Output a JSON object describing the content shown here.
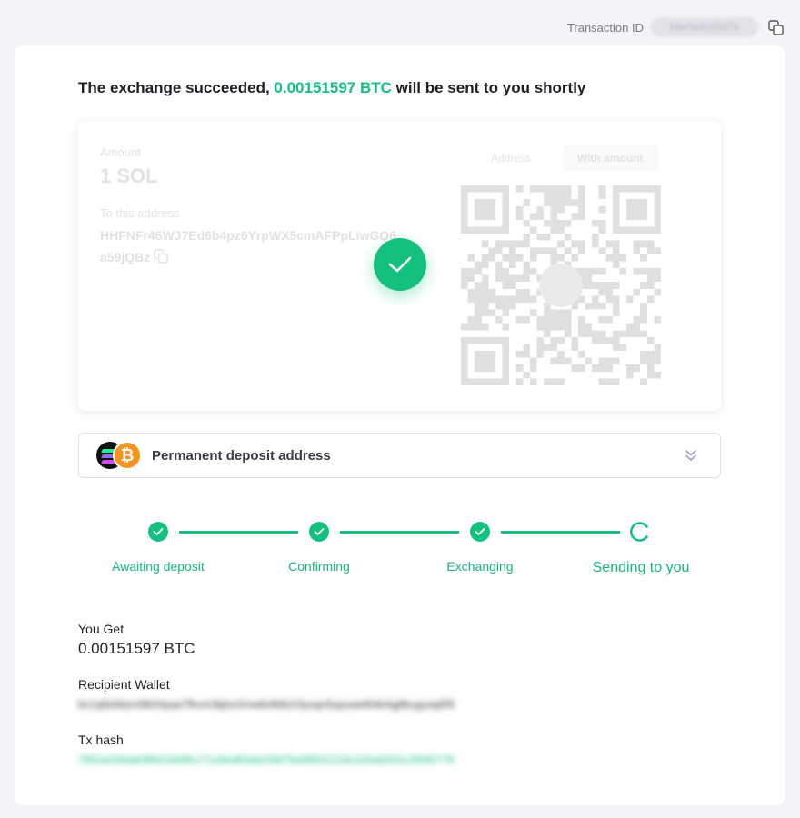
{
  "header": {
    "transaction_id_label": "Transaction ID",
    "transaction_id_value": "b8e0a9c1f2d7a",
    "copy_icon": "copy-icon"
  },
  "headline": {
    "prefix": "The exchange succeeded, ",
    "amount": "0.00151597 BTC",
    "suffix": " will be sent to you shortly"
  },
  "deposit": {
    "amount_label": "Amount",
    "amount_value": "1 SOL",
    "address_label": "To this address",
    "address": "HHFNFr46WJ7Ed6b4pz6YrpWX5cmAFPpLiwGQ6a59jQBz",
    "tabs": [
      "Address",
      "With amount"
    ],
    "active_tab": "With amount",
    "status_icon": "check-icon"
  },
  "permanent_address": {
    "label": "Permanent deposit address",
    "icons": [
      "solana-icon",
      "bitcoin-icon",
      "double-chevron-down-icon"
    ]
  },
  "steps": [
    {
      "label": "Awaiting deposit",
      "status": "done"
    },
    {
      "label": "Confirming",
      "status": "done"
    },
    {
      "label": "Exchanging",
      "status": "done"
    },
    {
      "label": "Sending to you",
      "status": "in-progress"
    }
  ],
  "result": {
    "you_get_label": "You Get",
    "you_get_value": "0.00151597 BTC",
    "recipient_label": "Recipient Wallet",
    "recipient_value": "bc1q5d4dzn0lk0rlpaa7fkvm3kjhx2mw8vfk8ch3yxqn5xpuaw6hlk4qj8kugzaq5f5",
    "tx_hash_label": "Tx hash",
    "tx_hash_value": "7f92ae04dab9f6d1b69fcc71a9ed63ab20bf7ba6954112dc2e0a8202c2f045778"
  },
  "colors": {
    "accent": "#13c07e",
    "page_bg": "#f3f3f8",
    "card_bg": "#ffffff",
    "bitcoin": "#f7931a"
  }
}
